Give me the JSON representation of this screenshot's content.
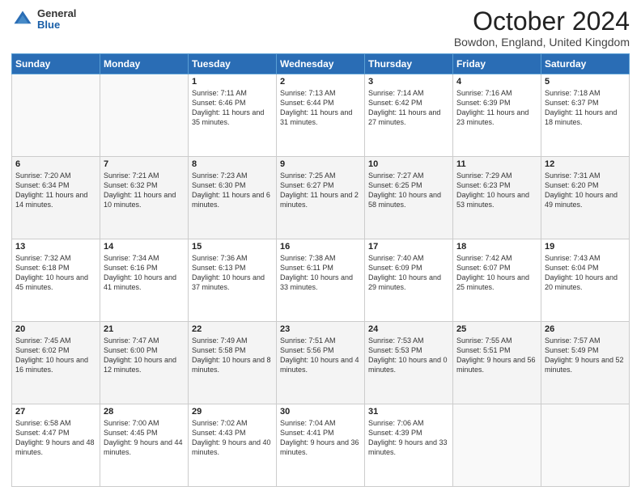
{
  "header": {
    "logo": {
      "general": "General",
      "blue": "Blue"
    },
    "title": "October 2024",
    "location": "Bowdon, England, United Kingdom"
  },
  "days_of_week": [
    "Sunday",
    "Monday",
    "Tuesday",
    "Wednesday",
    "Thursday",
    "Friday",
    "Saturday"
  ],
  "weeks": [
    [
      {
        "day": "",
        "info": ""
      },
      {
        "day": "",
        "info": ""
      },
      {
        "day": "1",
        "sunrise": "Sunrise: 7:11 AM",
        "sunset": "Sunset: 6:46 PM",
        "daylight": "Daylight: 11 hours and 35 minutes."
      },
      {
        "day": "2",
        "sunrise": "Sunrise: 7:13 AM",
        "sunset": "Sunset: 6:44 PM",
        "daylight": "Daylight: 11 hours and 31 minutes."
      },
      {
        "day": "3",
        "sunrise": "Sunrise: 7:14 AM",
        "sunset": "Sunset: 6:42 PM",
        "daylight": "Daylight: 11 hours and 27 minutes."
      },
      {
        "day": "4",
        "sunrise": "Sunrise: 7:16 AM",
        "sunset": "Sunset: 6:39 PM",
        "daylight": "Daylight: 11 hours and 23 minutes."
      },
      {
        "day": "5",
        "sunrise": "Sunrise: 7:18 AM",
        "sunset": "Sunset: 6:37 PM",
        "daylight": "Daylight: 11 hours and 18 minutes."
      }
    ],
    [
      {
        "day": "6",
        "sunrise": "Sunrise: 7:20 AM",
        "sunset": "Sunset: 6:34 PM",
        "daylight": "Daylight: 11 hours and 14 minutes."
      },
      {
        "day": "7",
        "sunrise": "Sunrise: 7:21 AM",
        "sunset": "Sunset: 6:32 PM",
        "daylight": "Daylight: 11 hours and 10 minutes."
      },
      {
        "day": "8",
        "sunrise": "Sunrise: 7:23 AM",
        "sunset": "Sunset: 6:30 PM",
        "daylight": "Daylight: 11 hours and 6 minutes."
      },
      {
        "day": "9",
        "sunrise": "Sunrise: 7:25 AM",
        "sunset": "Sunset: 6:27 PM",
        "daylight": "Daylight: 11 hours and 2 minutes."
      },
      {
        "day": "10",
        "sunrise": "Sunrise: 7:27 AM",
        "sunset": "Sunset: 6:25 PM",
        "daylight": "Daylight: 10 hours and 58 minutes."
      },
      {
        "day": "11",
        "sunrise": "Sunrise: 7:29 AM",
        "sunset": "Sunset: 6:23 PM",
        "daylight": "Daylight: 10 hours and 53 minutes."
      },
      {
        "day": "12",
        "sunrise": "Sunrise: 7:31 AM",
        "sunset": "Sunset: 6:20 PM",
        "daylight": "Daylight: 10 hours and 49 minutes."
      }
    ],
    [
      {
        "day": "13",
        "sunrise": "Sunrise: 7:32 AM",
        "sunset": "Sunset: 6:18 PM",
        "daylight": "Daylight: 10 hours and 45 minutes."
      },
      {
        "day": "14",
        "sunrise": "Sunrise: 7:34 AM",
        "sunset": "Sunset: 6:16 PM",
        "daylight": "Daylight: 10 hours and 41 minutes."
      },
      {
        "day": "15",
        "sunrise": "Sunrise: 7:36 AM",
        "sunset": "Sunset: 6:13 PM",
        "daylight": "Daylight: 10 hours and 37 minutes."
      },
      {
        "day": "16",
        "sunrise": "Sunrise: 7:38 AM",
        "sunset": "Sunset: 6:11 PM",
        "daylight": "Daylight: 10 hours and 33 minutes."
      },
      {
        "day": "17",
        "sunrise": "Sunrise: 7:40 AM",
        "sunset": "Sunset: 6:09 PM",
        "daylight": "Daylight: 10 hours and 29 minutes."
      },
      {
        "day": "18",
        "sunrise": "Sunrise: 7:42 AM",
        "sunset": "Sunset: 6:07 PM",
        "daylight": "Daylight: 10 hours and 25 minutes."
      },
      {
        "day": "19",
        "sunrise": "Sunrise: 7:43 AM",
        "sunset": "Sunset: 6:04 PM",
        "daylight": "Daylight: 10 hours and 20 minutes."
      }
    ],
    [
      {
        "day": "20",
        "sunrise": "Sunrise: 7:45 AM",
        "sunset": "Sunset: 6:02 PM",
        "daylight": "Daylight: 10 hours and 16 minutes."
      },
      {
        "day": "21",
        "sunrise": "Sunrise: 7:47 AM",
        "sunset": "Sunset: 6:00 PM",
        "daylight": "Daylight: 10 hours and 12 minutes."
      },
      {
        "day": "22",
        "sunrise": "Sunrise: 7:49 AM",
        "sunset": "Sunset: 5:58 PM",
        "daylight": "Daylight: 10 hours and 8 minutes."
      },
      {
        "day": "23",
        "sunrise": "Sunrise: 7:51 AM",
        "sunset": "Sunset: 5:56 PM",
        "daylight": "Daylight: 10 hours and 4 minutes."
      },
      {
        "day": "24",
        "sunrise": "Sunrise: 7:53 AM",
        "sunset": "Sunset: 5:53 PM",
        "daylight": "Daylight: 10 hours and 0 minutes."
      },
      {
        "day": "25",
        "sunrise": "Sunrise: 7:55 AM",
        "sunset": "Sunset: 5:51 PM",
        "daylight": "Daylight: 9 hours and 56 minutes."
      },
      {
        "day": "26",
        "sunrise": "Sunrise: 7:57 AM",
        "sunset": "Sunset: 5:49 PM",
        "daylight": "Daylight: 9 hours and 52 minutes."
      }
    ],
    [
      {
        "day": "27",
        "sunrise": "Sunrise: 6:58 AM",
        "sunset": "Sunset: 4:47 PM",
        "daylight": "Daylight: 9 hours and 48 minutes."
      },
      {
        "day": "28",
        "sunrise": "Sunrise: 7:00 AM",
        "sunset": "Sunset: 4:45 PM",
        "daylight": "Daylight: 9 hours and 44 minutes."
      },
      {
        "day": "29",
        "sunrise": "Sunrise: 7:02 AM",
        "sunset": "Sunset: 4:43 PM",
        "daylight": "Daylight: 9 hours and 40 minutes."
      },
      {
        "day": "30",
        "sunrise": "Sunrise: 7:04 AM",
        "sunset": "Sunset: 4:41 PM",
        "daylight": "Daylight: 9 hours and 36 minutes."
      },
      {
        "day": "31",
        "sunrise": "Sunrise: 7:06 AM",
        "sunset": "Sunset: 4:39 PM",
        "daylight": "Daylight: 9 hours and 33 minutes."
      },
      {
        "day": "",
        "info": ""
      },
      {
        "day": "",
        "info": ""
      }
    ]
  ]
}
